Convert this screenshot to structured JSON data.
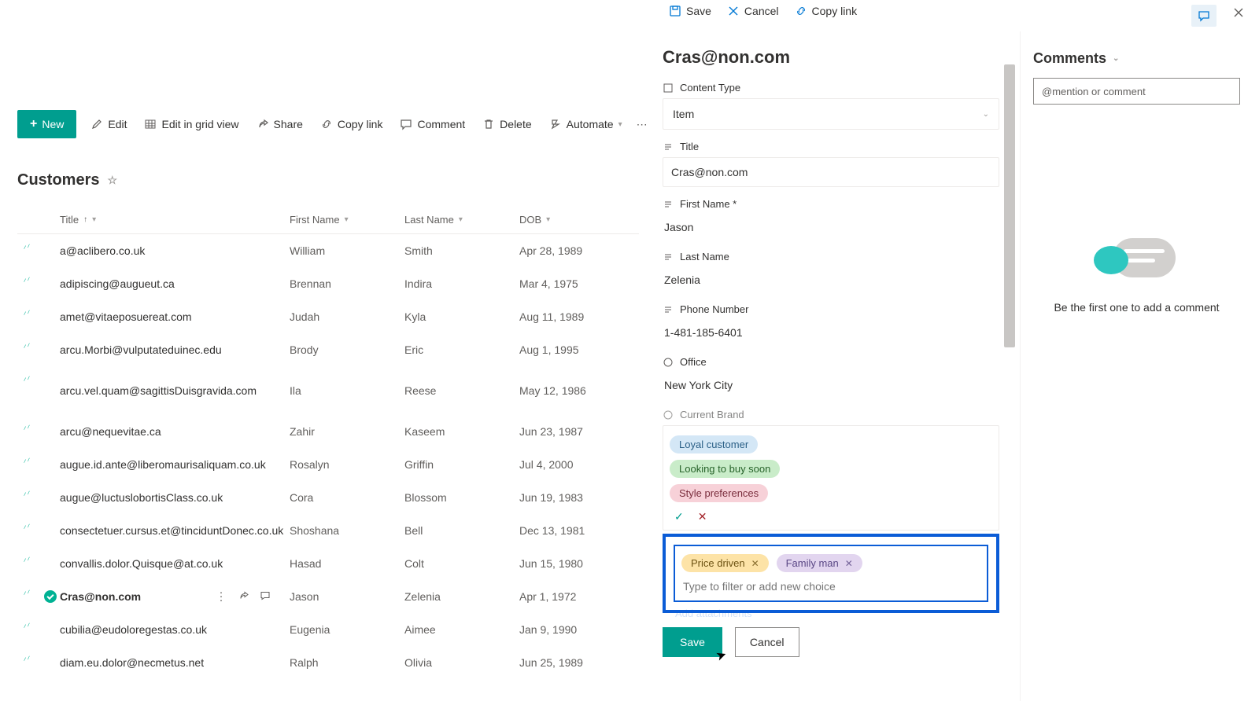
{
  "top": {
    "save": "Save",
    "cancel": "Cancel",
    "copylink": "Copy link"
  },
  "cmd": {
    "new": "New",
    "edit": "Edit",
    "grid": "Edit in grid view",
    "share": "Share",
    "copylink": "Copy link",
    "comment": "Comment",
    "delete": "Delete",
    "automate": "Automate"
  },
  "list": {
    "title": "Customers"
  },
  "columns": {
    "title": "Title",
    "first": "First Name",
    "last": "Last Name",
    "dob": "DOB"
  },
  "rows": [
    {
      "title": "a@aclibero.co.uk",
      "first": "William",
      "last": "Smith",
      "dob": "Apr 28, 1989"
    },
    {
      "title": "adipiscing@augueut.ca",
      "first": "Brennan",
      "last": "Indira",
      "dob": "Mar 4, 1975"
    },
    {
      "title": "amet@vitaeposuereat.com",
      "first": "Judah",
      "last": "Kyla",
      "dob": "Aug 11, 1989"
    },
    {
      "title": "arcu.Morbi@vulputateduinec.edu",
      "first": "Brody",
      "last": "Eric",
      "dob": "Aug 1, 1995"
    },
    {
      "title": "arcu.vel.quam@sagittisDuisgravida.com",
      "first": "Ila",
      "last": "Reese",
      "dob": "May 12, 1986"
    },
    {
      "title": "arcu@nequevitae.ca",
      "first": "Zahir",
      "last": "Kaseem",
      "dob": "Jun 23, 1987"
    },
    {
      "title": "augue.id.ante@liberomaurisaliquam.co.uk",
      "first": "Rosalyn",
      "last": "Griffin",
      "dob": "Jul 4, 2000"
    },
    {
      "title": "augue@luctuslobortisClass.co.uk",
      "first": "Cora",
      "last": "Blossom",
      "dob": "Jun 19, 1983"
    },
    {
      "title": "consectetuer.cursus.et@tinciduntDonec.co.uk",
      "first": "Shoshana",
      "last": "Bell",
      "dob": "Dec 13, 1981"
    },
    {
      "title": "convallis.dolor.Quisque@at.co.uk",
      "first": "Hasad",
      "last": "Colt",
      "dob": "Jun 15, 1980"
    },
    {
      "title": "Cras@non.com",
      "first": "Jason",
      "last": "Zelenia",
      "dob": "Apr 1, 1972",
      "selected": true
    },
    {
      "title": "cubilia@eudoloregestas.co.uk",
      "first": "Eugenia",
      "last": "Aimee",
      "dob": "Jan 9, 1990"
    },
    {
      "title": "diam.eu.dolor@necmetus.net",
      "first": "Ralph",
      "last": "Olivia",
      "dob": "Jun 25, 1989"
    }
  ],
  "panel": {
    "title": "Cras@non.com",
    "content_type_label": "Content Type",
    "content_type_value": "Item",
    "title_label": "Title",
    "title_value": "Cras@non.com",
    "first_label": "First Name *",
    "first_value": "Jason",
    "last_label": "Last Name",
    "last_value": "Zelenia",
    "phone_label": "Phone Number",
    "phone_value": "1-481-185-6401",
    "office_label": "Office",
    "office_value": "New York City",
    "brand_label": "Current Brand",
    "suggestions": {
      "loyal": "Loyal customer",
      "looking": "Looking to buy soon",
      "style": "Style preferences"
    },
    "chosen": {
      "price": "Price driven",
      "family": "Family man"
    },
    "filter_placeholder": "Type to filter or add new choice",
    "add_attachments": "Add attachments",
    "save": "Save",
    "cancel": "Cancel"
  },
  "comments": {
    "heading": "Comments",
    "placeholder": "@mention or comment",
    "empty": "Be the first one to add a comment"
  }
}
